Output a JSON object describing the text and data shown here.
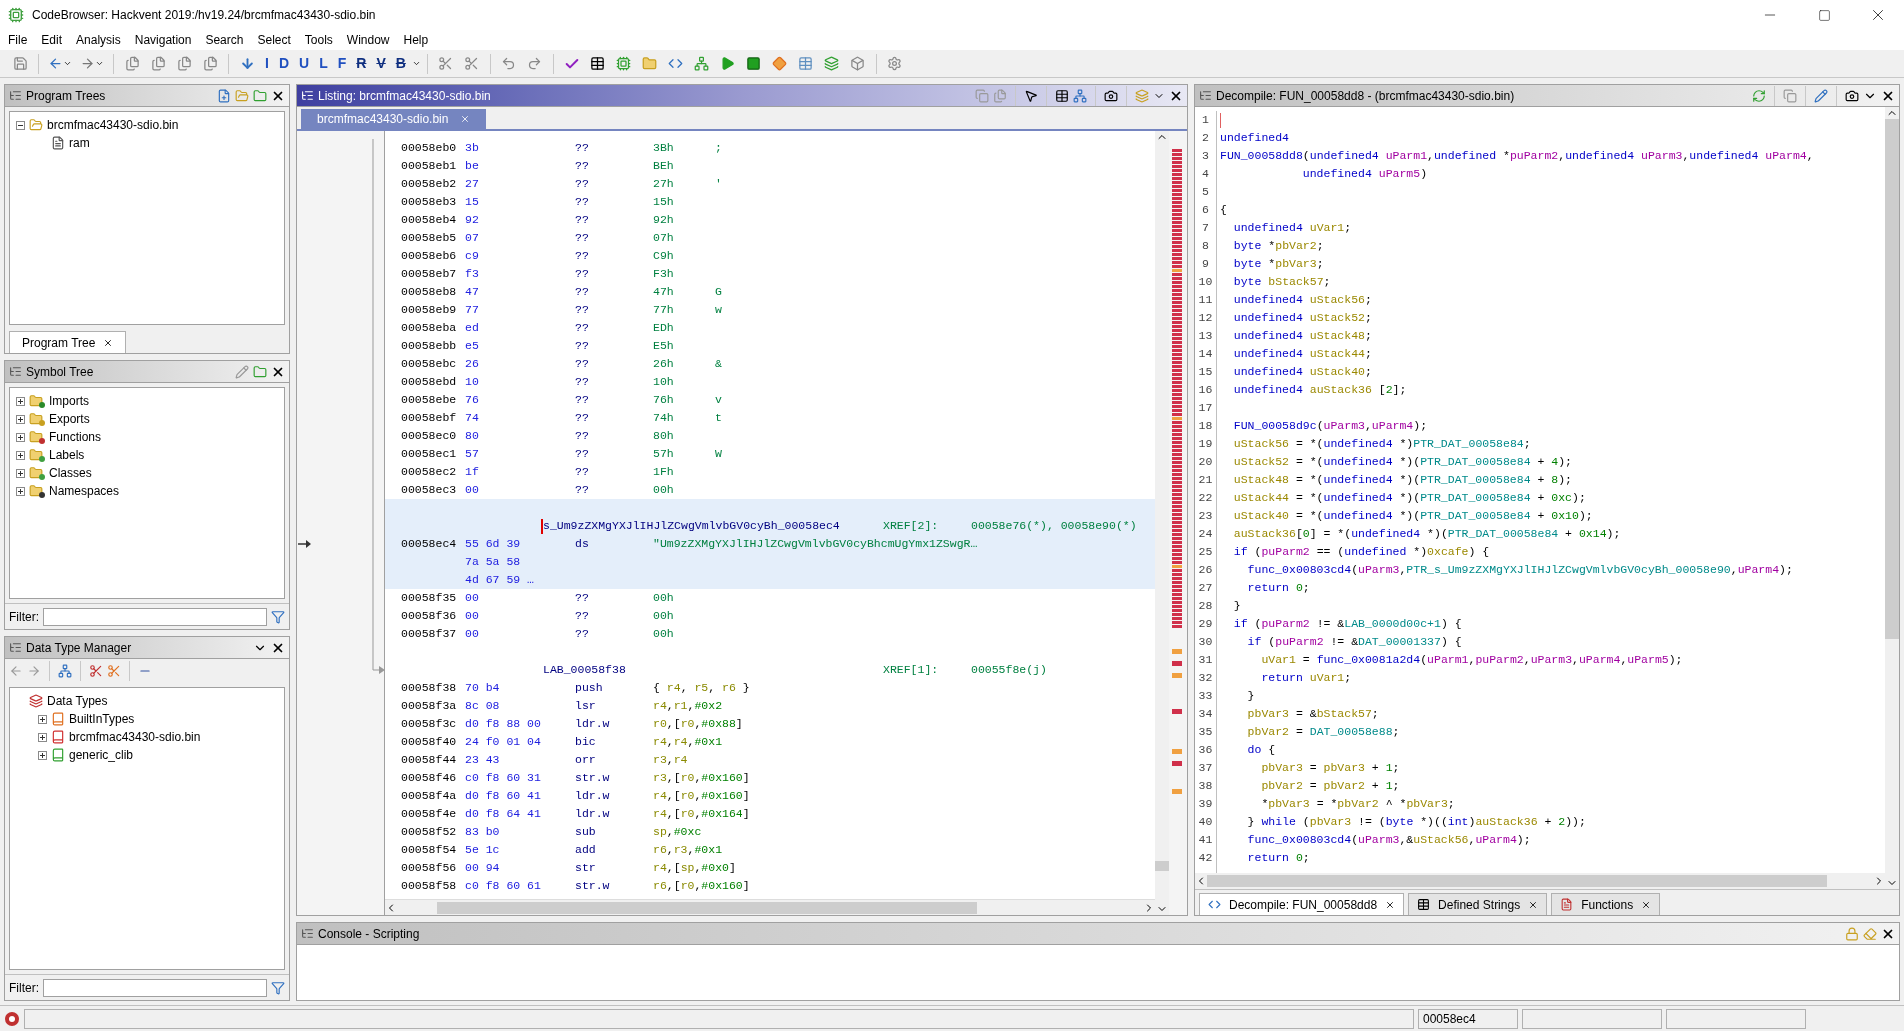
{
  "window": {
    "title": "CodeBrowser: Hackvent 2019:/hv19.24/brcmfmac43430-sdio.bin"
  },
  "menu": [
    "File",
    "Edit",
    "Analysis",
    "Navigation",
    "Search",
    "Select",
    "Tools",
    "Window",
    "Help"
  ],
  "toolbar": {
    "nav_letters": [
      "I",
      "D",
      "U",
      "L",
      "F",
      "R",
      "V",
      "B"
    ]
  },
  "program_trees": {
    "title": "Program Trees",
    "tree": [
      {
        "label": "brcmfmac43430-sdio.bin",
        "expanded": true,
        "children": [
          {
            "label": "ram"
          }
        ]
      }
    ],
    "tabs": [
      {
        "label": "Program Tree",
        "selected": true
      }
    ]
  },
  "symbol_tree": {
    "title": "Symbol Tree",
    "tree": [
      {
        "label": "Imports",
        "expanded": false
      },
      {
        "label": "Exports",
        "expanded": false
      },
      {
        "label": "Functions",
        "expanded": false
      },
      {
        "label": "Labels",
        "expanded": false
      },
      {
        "label": "Classes",
        "expanded": false
      },
      {
        "label": "Namespaces",
        "expanded": false
      }
    ],
    "filter_label": "Filter:"
  },
  "data_type_manager": {
    "title": "Data Type Manager",
    "tree": [
      {
        "label": "Data Types",
        "children": [
          {
            "label": "BuiltInTypes",
            "expanded": false
          },
          {
            "label": "brcmfmac43430-sdio.bin",
            "expanded": false
          },
          {
            "label": "generic_clib",
            "expanded": false
          }
        ]
      }
    ],
    "filter_label": "Filter:"
  },
  "listing": {
    "title": "Listing: brcmfmac43430-sdio.bin",
    "tabs": [
      {
        "label": "brcmfmac43430-sdio.bin",
        "selected": true
      }
    ],
    "rows": [
      {
        "kind": "data",
        "address": "00058eb0",
        "bytes": "3b",
        "mnemonic": "??",
        "operand": "3Bh",
        "comment": ";",
        "selected": false
      },
      {
        "kind": "data",
        "address": "00058eb1",
        "bytes": "be",
        "mnemonic": "??",
        "operand": "BEh",
        "selected": false
      },
      {
        "kind": "data",
        "address": "00058eb2",
        "bytes": "27",
        "mnemonic": "??",
        "operand": "27h",
        "comment": "'",
        "selected": false
      },
      {
        "kind": "data",
        "address": "00058eb3",
        "bytes": "15",
        "mnemonic": "??",
        "operand": "15h",
        "selected": false
      },
      {
        "kind": "data",
        "address": "00058eb4",
        "bytes": "92",
        "mnemonic": "??",
        "operand": "92h",
        "selected": false
      },
      {
        "kind": "data",
        "address": "00058eb5",
        "bytes": "07",
        "mnemonic": "??",
        "operand": "07h",
        "selected": false
      },
      {
        "kind": "data",
        "address": "00058eb6",
        "bytes": "c9",
        "mnemonic": "??",
        "operand": "C9h",
        "selected": false
      },
      {
        "kind": "data",
        "address": "00058eb7",
        "bytes": "f3",
        "mnemonic": "??",
        "operand": "F3h",
        "selected": false
      },
      {
        "kind": "data",
        "address": "00058eb8",
        "bytes": "47",
        "mnemonic": "??",
        "operand": "47h",
        "comment": "G",
        "selected": false
      },
      {
        "kind": "data",
        "address": "00058eb9",
        "bytes": "77",
        "mnemonic": "??",
        "operand": "77h",
        "comment": "w",
        "selected": false
      },
      {
        "kind": "data",
        "address": "00058eba",
        "bytes": "ed",
        "mnemonic": "??",
        "operand": "EDh",
        "selected": false
      },
      {
        "kind": "data",
        "address": "00058ebb",
        "bytes": "e5",
        "mnemonic": "??",
        "operand": "E5h",
        "selected": false
      },
      {
        "kind": "data",
        "address": "00058ebc",
        "bytes": "26",
        "mnemonic": "??",
        "operand": "26h",
        "comment": "&",
        "selected": false
      },
      {
        "kind": "data",
        "address": "00058ebd",
        "bytes": "10",
        "mnemonic": "??",
        "operand": "10h",
        "selected": false
      },
      {
        "kind": "data",
        "address": "00058ebe",
        "bytes": "76",
        "mnemonic": "??",
        "operand": "76h",
        "comment": "v",
        "selected": false
      },
      {
        "kind": "data",
        "address": "00058ebf",
        "bytes": "74",
        "mnemonic": "??",
        "operand": "74h",
        "comment": "t",
        "selected": false
      },
      {
        "kind": "data",
        "address": "00058ec0",
        "bytes": "80",
        "mnemonic": "??",
        "operand": "80h",
        "selected": false
      },
      {
        "kind": "data",
        "address": "00058ec1",
        "bytes": "57",
        "mnemonic": "??",
        "operand": "57h",
        "comment": "W",
        "selected": false
      },
      {
        "kind": "data",
        "address": "00058ec2",
        "bytes": "1f",
        "mnemonic": "??",
        "operand": "1Fh",
        "selected": false
      },
      {
        "kind": "data",
        "address": "00058ec3",
        "bytes": "00",
        "mnemonic": "??",
        "operand": "00h",
        "selected": false
      },
      {
        "kind": "blank",
        "selected": true
      },
      {
        "kind": "label",
        "label": "s_Um9zZXMgYXJlIHJlZCwgVmlvbGV0cyBh_00058ec4",
        "xref_label": "XREF[2]:",
        "xrefs": "00058e76(*), 00058e90(*)",
        "cursor": true,
        "selected": true
      },
      {
        "kind": "data",
        "address": "00058ec4",
        "bytes": "55 6d 39",
        "mnemonic": "ds",
        "operand": "\"Um9zZXMgYXJlIHJlZCwgVmlvbGV0cyBhcmUgYmx1ZSwgR…",
        "selected": true
      },
      {
        "kind": "bytes",
        "bytes": "7a 5a 58",
        "selected": true
      },
      {
        "kind": "bytes",
        "bytes": "4d 67 59 …",
        "selected": true
      },
      {
        "kind": "data",
        "address": "00058f35",
        "bytes": "00",
        "mnemonic": "??",
        "operand": "00h",
        "selected": false
      },
      {
        "kind": "data",
        "address": "00058f36",
        "bytes": "00",
        "mnemonic": "??",
        "operand": "00h",
        "selected": false
      },
      {
        "kind": "data",
        "address": "00058f37",
        "bytes": "00",
        "mnemonic": "??",
        "operand": "00h",
        "selected": false
      },
      {
        "kind": "blank",
        "selected": false
      },
      {
        "kind": "label",
        "label": "LAB_00058f38",
        "xref_label": "XREF[1]:",
        "xrefs": "00055f8e(j)",
        "selected": false
      },
      {
        "kind": "instruction",
        "address": "00058f38",
        "bytes": "70 b4",
        "mnemonic": "push",
        "operand": "{ r4, r5, r6 }",
        "selected": false
      },
      {
        "kind": "instruction",
        "address": "00058f3a",
        "bytes": "8c 08",
        "mnemonic": "lsr",
        "operand": "r4,r1,#0x2",
        "selected": false
      },
      {
        "kind": "instruction",
        "address": "00058f3c",
        "bytes": "d0 f8 88 00",
        "mnemonic": "ldr.w",
        "operand": "r0,[r0,#0x88]",
        "selected": false
      },
      {
        "kind": "instruction",
        "address": "00058f40",
        "bytes": "24 f0 01 04",
        "mnemonic": "bic",
        "operand": "r4,r4,#0x1",
        "selected": false
      },
      {
        "kind": "instruction",
        "address": "00058f44",
        "bytes": "23 43",
        "mnemonic": "orr",
        "operand": "r3,r4",
        "selected": false
      },
      {
        "kind": "instruction",
        "address": "00058f46",
        "bytes": "c0 f8 60 31",
        "mnemonic": "str.w",
        "operand": "r3,[r0,#0x160]",
        "selected": false
      },
      {
        "kind": "instruction",
        "address": "00058f4a",
        "bytes": "d0 f8 60 41",
        "mnemonic": "ldr.w",
        "operand": "r4,[r0,#0x160]",
        "selected": false
      },
      {
        "kind": "instruction",
        "address": "00058f4e",
        "bytes": "d0 f8 64 41",
        "mnemonic": "ldr.w",
        "operand": "r4,[r0,#0x164]",
        "selected": false
      },
      {
        "kind": "instruction",
        "address": "00058f52",
        "bytes": "83 b0",
        "mnemonic": "sub",
        "operand": "sp,#0xc",
        "selected": false
      },
      {
        "kind": "instruction",
        "address": "00058f54",
        "bytes": "5e 1c",
        "mnemonic": "add",
        "operand": "r6,r3,#0x1",
        "selected": false
      },
      {
        "kind": "instruction",
        "address": "00058f56",
        "bytes": "00 94",
        "mnemonic": "str",
        "operand": "r4,[sp,#0x0]",
        "selected": false
      },
      {
        "kind": "instruction",
        "address": "00058f58",
        "bytes": "c0 f8 60 61",
        "mnemonic": "str.w",
        "operand": "r6,[r0,#0x160]",
        "selected": false
      }
    ]
  },
  "decompile": {
    "title": "Decompile: FUN_00058dd8 -  (brcmfmac43430-sdio.bin)",
    "lines": [
      {
        "number": "1"
      },
      {
        "number": "2",
        "tokens": [
          {
            "kind": "kw",
            "text": "undefined4"
          }
        ]
      },
      {
        "number": "3",
        "tokens": [
          {
            "kind": "kw",
            "text": "FUN_00058dd8"
          },
          {
            "kind": "plain",
            "text": "("
          },
          {
            "kind": "kw",
            "text": "undefined4"
          },
          {
            "kind": "param",
            "text": " uParm1"
          },
          {
            "kind": "plain",
            "text": ","
          },
          {
            "kind": "kw",
            "text": "undefined"
          },
          {
            "kind": "plain",
            "text": " *"
          },
          {
            "kind": "param",
            "text": "puParm2"
          },
          {
            "kind": "plain",
            "text": ","
          },
          {
            "kind": "kw",
            "text": "undefined4"
          },
          {
            "kind": "param",
            "text": " uParm3"
          },
          {
            "kind": "plain",
            "text": ","
          },
          {
            "kind": "kw",
            "text": "undefined4"
          },
          {
            "kind": "param",
            "text": " uParm4"
          },
          {
            "kind": "plain",
            "text": ","
          }
        ]
      },
      {
        "number": "4",
        "tokens": [
          {
            "kind": "kw",
            "text": "            undefined4"
          },
          {
            "kind": "param",
            "text": " uParm5"
          },
          {
            "kind": "plain",
            "text": ")"
          }
        ]
      },
      {
        "number": "5"
      },
      {
        "number": "6",
        "tokens": [
          {
            "kind": "plain",
            "text": "{"
          }
        ]
      },
      {
        "number": "7",
        "tokens": [
          {
            "kind": "kw",
            "text": "  undefined4"
          },
          {
            "kind": "var",
            "text": " uVar1"
          },
          {
            "kind": "plain",
            "text": ";"
          }
        ]
      },
      {
        "number": "8",
        "tokens": [
          {
            "kind": "kw",
            "text": "  byte"
          },
          {
            "kind": "plain",
            "text": " *"
          },
          {
            "kind": "var",
            "text": "pbVar2"
          },
          {
            "kind": "plain",
            "text": ";"
          }
        ]
      },
      {
        "number": "9",
        "tokens": [
          {
            "kind": "kw",
            "text": "  byte"
          },
          {
            "kind": "plain",
            "text": " *"
          },
          {
            "kind": "var",
            "text": "pbVar3"
          },
          {
            "kind": "plain",
            "text": ";"
          }
        ]
      },
      {
        "number": "10",
        "tokens": [
          {
            "kind": "kw",
            "text": "  byte"
          },
          {
            "kind": "var",
            "text": " bStack57"
          },
          {
            "kind": "plain",
            "text": ";"
          }
        ]
      },
      {
        "number": "11",
        "tokens": [
          {
            "kind": "kw",
            "text": "  undefined4"
          },
          {
            "kind": "var",
            "text": " uStack56"
          },
          {
            "kind": "plain",
            "text": ";"
          }
        ]
      },
      {
        "number": "12",
        "tokens": [
          {
            "kind": "kw",
            "text": "  undefined4"
          },
          {
            "kind": "var",
            "text": " uStack52"
          },
          {
            "kind": "plain",
            "text": ";"
          }
        ]
      },
      {
        "number": "13",
        "tokens": [
          {
            "kind": "kw",
            "text": "  undefined4"
          },
          {
            "kind": "var",
            "text": " uStack48"
          },
          {
            "kind": "plain",
            "text": ";"
          }
        ]
      },
      {
        "number": "14",
        "tokens": [
          {
            "kind": "kw",
            "text": "  undefined4"
          },
          {
            "kind": "var",
            "text": " uStack44"
          },
          {
            "kind": "plain",
            "text": ";"
          }
        ]
      },
      {
        "number": "15",
        "tokens": [
          {
            "kind": "kw",
            "text": "  undefined4"
          },
          {
            "kind": "var",
            "text": " uStack40"
          },
          {
            "kind": "plain",
            "text": ";"
          }
        ]
      },
      {
        "number": "16",
        "tokens": [
          {
            "kind": "kw",
            "text": "  undefined4"
          },
          {
            "kind": "var",
            "text": " auStack36"
          },
          {
            "kind": "plain",
            "text": " ["
          },
          {
            "kind": "num",
            "text": "2"
          },
          {
            "kind": "plain",
            "text": "];"
          }
        ]
      },
      {
        "number": "17"
      },
      {
        "number": "18",
        "tokens": [
          {
            "kind": "kw",
            "text": "  FUN_00058d9c"
          },
          {
            "kind": "plain",
            "text": "("
          },
          {
            "kind": "param",
            "text": "uParm3"
          },
          {
            "kind": "plain",
            "text": ","
          },
          {
            "kind": "param",
            "text": "uParm4"
          },
          {
            "kind": "plain",
            "text": ");"
          }
        ]
      },
      {
        "number": "19",
        "tokens": [
          {
            "kind": "var",
            "text": "  uStack56"
          },
          {
            "kind": "plain",
            "text": " = *("
          },
          {
            "kind": "kw",
            "text": "undefined4"
          },
          {
            "kind": "plain",
            "text": " *)"
          },
          {
            "kind": "global",
            "text": "PTR_DAT_00058e84"
          },
          {
            "kind": "plain",
            "text": ";"
          }
        ]
      },
      {
        "number": "20",
        "tokens": [
          {
            "kind": "var",
            "text": "  uStack52"
          },
          {
            "kind": "plain",
            "text": " = *("
          },
          {
            "kind": "kw",
            "text": "undefined4"
          },
          {
            "kind": "plain",
            "text": " *)("
          },
          {
            "kind": "global",
            "text": "PTR_DAT_00058e84"
          },
          {
            "kind": "plain",
            "text": " + "
          },
          {
            "kind": "num",
            "text": "4"
          },
          {
            "kind": "plain",
            "text": ");"
          }
        ]
      },
      {
        "number": "21",
        "tokens": [
          {
            "kind": "var",
            "text": "  uStack48"
          },
          {
            "kind": "plain",
            "text": " = *("
          },
          {
            "kind": "kw",
            "text": "undefined4"
          },
          {
            "kind": "plain",
            "text": " *)("
          },
          {
            "kind": "global",
            "text": "PTR_DAT_00058e84"
          },
          {
            "kind": "plain",
            "text": " + "
          },
          {
            "kind": "num",
            "text": "8"
          },
          {
            "kind": "plain",
            "text": ");"
          }
        ]
      },
      {
        "number": "22",
        "tokens": [
          {
            "kind": "var",
            "text": "  uStack44"
          },
          {
            "kind": "plain",
            "text": " = *("
          },
          {
            "kind": "kw",
            "text": "undefined4"
          },
          {
            "kind": "plain",
            "text": " *)("
          },
          {
            "kind": "global",
            "text": "PTR_DAT_00058e84"
          },
          {
            "kind": "plain",
            "text": " + "
          },
          {
            "kind": "num",
            "text": "0xc"
          },
          {
            "kind": "plain",
            "text": ");"
          }
        ]
      },
      {
        "number": "23",
        "tokens": [
          {
            "kind": "var",
            "text": "  uStack40"
          },
          {
            "kind": "plain",
            "text": " = *("
          },
          {
            "kind": "kw",
            "text": "undefined4"
          },
          {
            "kind": "plain",
            "text": " *)("
          },
          {
            "kind": "global",
            "text": "PTR_DAT_00058e84"
          },
          {
            "kind": "plain",
            "text": " + "
          },
          {
            "kind": "num",
            "text": "0x10"
          },
          {
            "kind": "plain",
            "text": ");"
          }
        ]
      },
      {
        "number": "24",
        "tokens": [
          {
            "kind": "var",
            "text": "  auStack36"
          },
          {
            "kind": "plain",
            "text": "["
          },
          {
            "kind": "num",
            "text": "0"
          },
          {
            "kind": "plain",
            "text": "] = *("
          },
          {
            "kind": "kw",
            "text": "undefined4"
          },
          {
            "kind": "plain",
            "text": " *)("
          },
          {
            "kind": "global",
            "text": "PTR_DAT_00058e84"
          },
          {
            "kind": "plain",
            "text": " + "
          },
          {
            "kind": "num",
            "text": "0x14"
          },
          {
            "kind": "plain",
            "text": ");"
          }
        ]
      },
      {
        "number": "25",
        "tokens": [
          {
            "kind": "kw",
            "text": "  if"
          },
          {
            "kind": "plain",
            "text": " ("
          },
          {
            "kind": "param",
            "text": "puParm2"
          },
          {
            "kind": "plain",
            "text": " == ("
          },
          {
            "kind": "kw",
            "text": "undefined"
          },
          {
            "kind": "plain",
            "text": " *)"
          },
          {
            "kind": "var",
            "text": "0xcafe"
          },
          {
            "kind": "plain",
            "text": ") {"
          }
        ]
      },
      {
        "number": "26",
        "tokens": [
          {
            "kind": "kw",
            "text": "    func_0x00803cd4"
          },
          {
            "kind": "plain",
            "text": "("
          },
          {
            "kind": "param",
            "text": "uParm3"
          },
          {
            "kind": "plain",
            "text": ","
          },
          {
            "kind": "global",
            "text": "PTR_s_Um9zZXMgYXJlIHJlZCwgVmlvbGV0cyBh_00058e90"
          },
          {
            "kind": "plain",
            "text": ","
          },
          {
            "kind": "param",
            "text": "uParm4"
          },
          {
            "kind": "plain",
            "text": ");"
          }
        ]
      },
      {
        "number": "27",
        "tokens": [
          {
            "kind": "kw",
            "text": "    return"
          },
          {
            "kind": "num",
            "text": " 0"
          },
          {
            "kind": "plain",
            "text": ";"
          }
        ]
      },
      {
        "number": "28",
        "tokens": [
          {
            "kind": "plain",
            "text": "  }"
          }
        ]
      },
      {
        "number": "29",
        "tokens": [
          {
            "kind": "kw",
            "text": "  if"
          },
          {
            "kind": "plain",
            "text": " ("
          },
          {
            "kind": "param",
            "text": "puParm2"
          },
          {
            "kind": "plain",
            "text": " != &"
          },
          {
            "kind": "global",
            "text": "LAB_0000d00c+1"
          },
          {
            "kind": "plain",
            "text": ") {"
          }
        ]
      },
      {
        "number": "30",
        "tokens": [
          {
            "kind": "kw",
            "text": "    if"
          },
          {
            "kind": "plain",
            "text": " ("
          },
          {
            "kind": "param",
            "text": "puParm2"
          },
          {
            "kind": "plain",
            "text": " != &"
          },
          {
            "kind": "global",
            "text": "DAT_00001337"
          },
          {
            "kind": "plain",
            "text": ") {"
          }
        ]
      },
      {
        "number": "31",
        "tokens": [
          {
            "kind": "var",
            "text": "      uVar1"
          },
          {
            "kind": "plain",
            "text": " = "
          },
          {
            "kind": "kw",
            "text": "func_0x0081a2d4"
          },
          {
            "kind": "plain",
            "text": "("
          },
          {
            "kind": "param",
            "text": "uParm1"
          },
          {
            "kind": "plain",
            "text": ","
          },
          {
            "kind": "param",
            "text": "puParm2"
          },
          {
            "kind": "plain",
            "text": ","
          },
          {
            "kind": "param",
            "text": "uParm3"
          },
          {
            "kind": "plain",
            "text": ","
          },
          {
            "kind": "param",
            "text": "uParm4"
          },
          {
            "kind": "plain",
            "text": ","
          },
          {
            "kind": "param",
            "text": "uParm5"
          },
          {
            "kind": "plain",
            "text": ");"
          }
        ]
      },
      {
        "number": "32",
        "tokens": [
          {
            "kind": "kw",
            "text": "      return"
          },
          {
            "kind": "var",
            "text": " uVar1"
          },
          {
            "kind": "plain",
            "text": ";"
          }
        ]
      },
      {
        "number": "33",
        "tokens": [
          {
            "kind": "plain",
            "text": "    }"
          }
        ]
      },
      {
        "number": "34",
        "tokens": [
          {
            "kind": "var",
            "text": "    pbVar3"
          },
          {
            "kind": "plain",
            "text": " = &"
          },
          {
            "kind": "var",
            "text": "bStack57"
          },
          {
            "kind": "plain",
            "text": ";"
          }
        ]
      },
      {
        "number": "35",
        "tokens": [
          {
            "kind": "var",
            "text": "    pbVar2"
          },
          {
            "kind": "plain",
            "text": " = "
          },
          {
            "kind": "global",
            "text": "DAT_00058e88"
          },
          {
            "kind": "plain",
            "text": ";"
          }
        ]
      },
      {
        "number": "36",
        "tokens": [
          {
            "kind": "kw",
            "text": "    do"
          },
          {
            "kind": "plain",
            "text": " {"
          }
        ]
      },
      {
        "number": "37",
        "tokens": [
          {
            "kind": "var",
            "text": "      pbVar3"
          },
          {
            "kind": "plain",
            "text": " = "
          },
          {
            "kind": "var",
            "text": "pbVar3"
          },
          {
            "kind": "plain",
            "text": " + "
          },
          {
            "kind": "num",
            "text": "1"
          },
          {
            "kind": "plain",
            "text": ";"
          }
        ]
      },
      {
        "number": "38",
        "tokens": [
          {
            "kind": "var",
            "text": "      pbVar2"
          },
          {
            "kind": "plain",
            "text": " = "
          },
          {
            "kind": "var",
            "text": "pbVar2"
          },
          {
            "kind": "plain",
            "text": " + "
          },
          {
            "kind": "num",
            "text": "1"
          },
          {
            "kind": "plain",
            "text": ";"
          }
        ]
      },
      {
        "number": "39",
        "tokens": [
          {
            "kind": "plain",
            "text": "      *"
          },
          {
            "kind": "var",
            "text": "pbVar3"
          },
          {
            "kind": "plain",
            "text": " = *"
          },
          {
            "kind": "var",
            "text": "pbVar2"
          },
          {
            "kind": "plain",
            "text": " ^ *"
          },
          {
            "kind": "var",
            "text": "pbVar3"
          },
          {
            "kind": "plain",
            "text": ";"
          }
        ]
      },
      {
        "number": "40",
        "tokens": [
          {
            "kind": "plain",
            "text": "    } "
          },
          {
            "kind": "kw",
            "text": "while"
          },
          {
            "kind": "plain",
            "text": " ("
          },
          {
            "kind": "var",
            "text": "pbVar3"
          },
          {
            "kind": "plain",
            "text": " != ("
          },
          {
            "kind": "kw",
            "text": "byte"
          },
          {
            "kind": "plain",
            "text": " *)(("
          },
          {
            "kind": "kw",
            "text": "int"
          },
          {
            "kind": "plain",
            "text": ")"
          },
          {
            "kind": "var",
            "text": "auStack36"
          },
          {
            "kind": "plain",
            "text": " + "
          },
          {
            "kind": "num",
            "text": "2"
          },
          {
            "kind": "plain",
            "text": "));"
          }
        ]
      },
      {
        "number": "41",
        "tokens": [
          {
            "kind": "kw",
            "text": "    func_0x00803cd4"
          },
          {
            "kind": "plain",
            "text": "("
          },
          {
            "kind": "param",
            "text": "uParm3"
          },
          {
            "kind": "plain",
            "text": ",&"
          },
          {
            "kind": "var",
            "text": "uStack56"
          },
          {
            "kind": "plain",
            "text": ","
          },
          {
            "kind": "param",
            "text": "uParm4"
          },
          {
            "kind": "plain",
            "text": ");"
          }
        ]
      },
      {
        "number": "42",
        "tokens": [
          {
            "kind": "kw",
            "text": "    return"
          },
          {
            "kind": "num",
            "text": " 0"
          },
          {
            "kind": "plain",
            "text": ";"
          }
        ]
      }
    ],
    "tabs": [
      {
        "label": "Decompile: FUN_00058dd8",
        "selected": true
      },
      {
        "label": "Defined Strings",
        "selected": false
      },
      {
        "label": "Functions",
        "selected": false
      }
    ]
  },
  "console": {
    "title": "Console - Scripting"
  },
  "status_bar": {
    "address": "00058ec4"
  }
}
